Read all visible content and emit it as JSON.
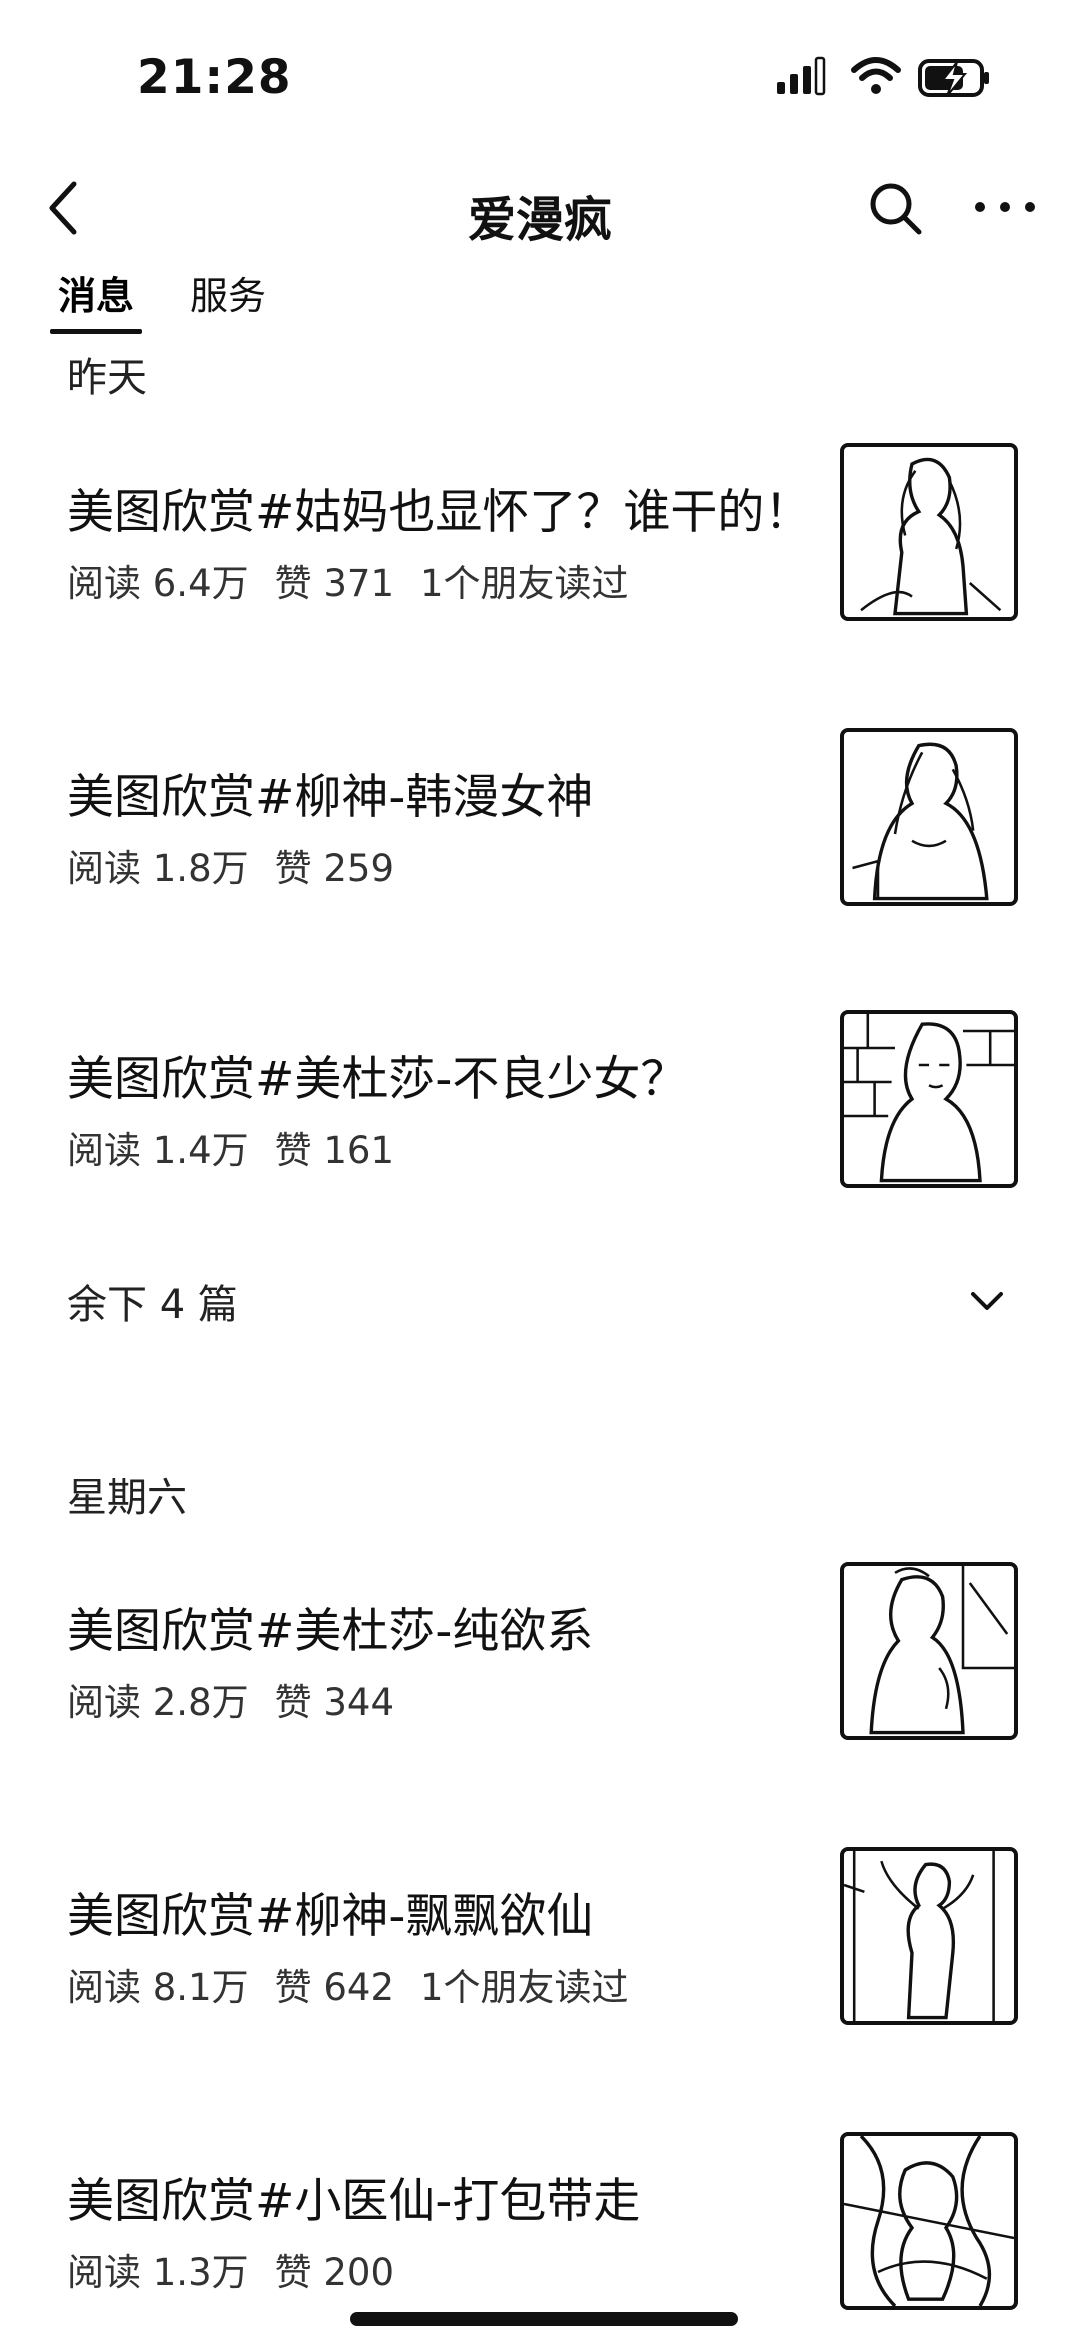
{
  "status_bar": {
    "time": "21:28",
    "icons": [
      "signal-icon",
      "wifi-icon",
      "battery-charging-icon"
    ]
  },
  "nav": {
    "title": "爱漫疯",
    "icons": [
      "back-icon",
      "search-icon",
      "more-icon"
    ]
  },
  "tabs": [
    {
      "label": "消息",
      "active": true
    },
    {
      "label": "服务",
      "active": false
    }
  ],
  "sections": [
    {
      "date": "昨天",
      "articles": [
        {
          "title": "美图欣赏#姑妈也显怀了？谁干的！",
          "reads": "阅读 6.4万",
          "likes": "赞 371",
          "friends": "1个朋友读过"
        },
        {
          "title": "美图欣赏#柳神-韩漫女神",
          "reads": "阅读 1.8万",
          "likes": "赞 259",
          "friends": ""
        },
        {
          "title": "美图欣赏#美杜莎-不良少女？",
          "reads": "阅读 1.4万",
          "likes": "赞 161",
          "friends": ""
        }
      ],
      "more": "余下 4 篇"
    },
    {
      "date": "星期六",
      "articles": [
        {
          "title": "美图欣赏#美杜莎-纯欲系",
          "reads": "阅读 2.8万",
          "likes": "赞 344",
          "friends": ""
        },
        {
          "title": "美图欣赏#柳神-飘飘欲仙",
          "reads": "阅读 8.1万",
          "likes": "赞 642",
          "friends": "1个朋友读过"
        },
        {
          "title": "美图欣赏#小医仙-打包带走",
          "reads": "阅读 1.3万",
          "likes": "赞 200",
          "friends": ""
        }
      ]
    }
  ]
}
